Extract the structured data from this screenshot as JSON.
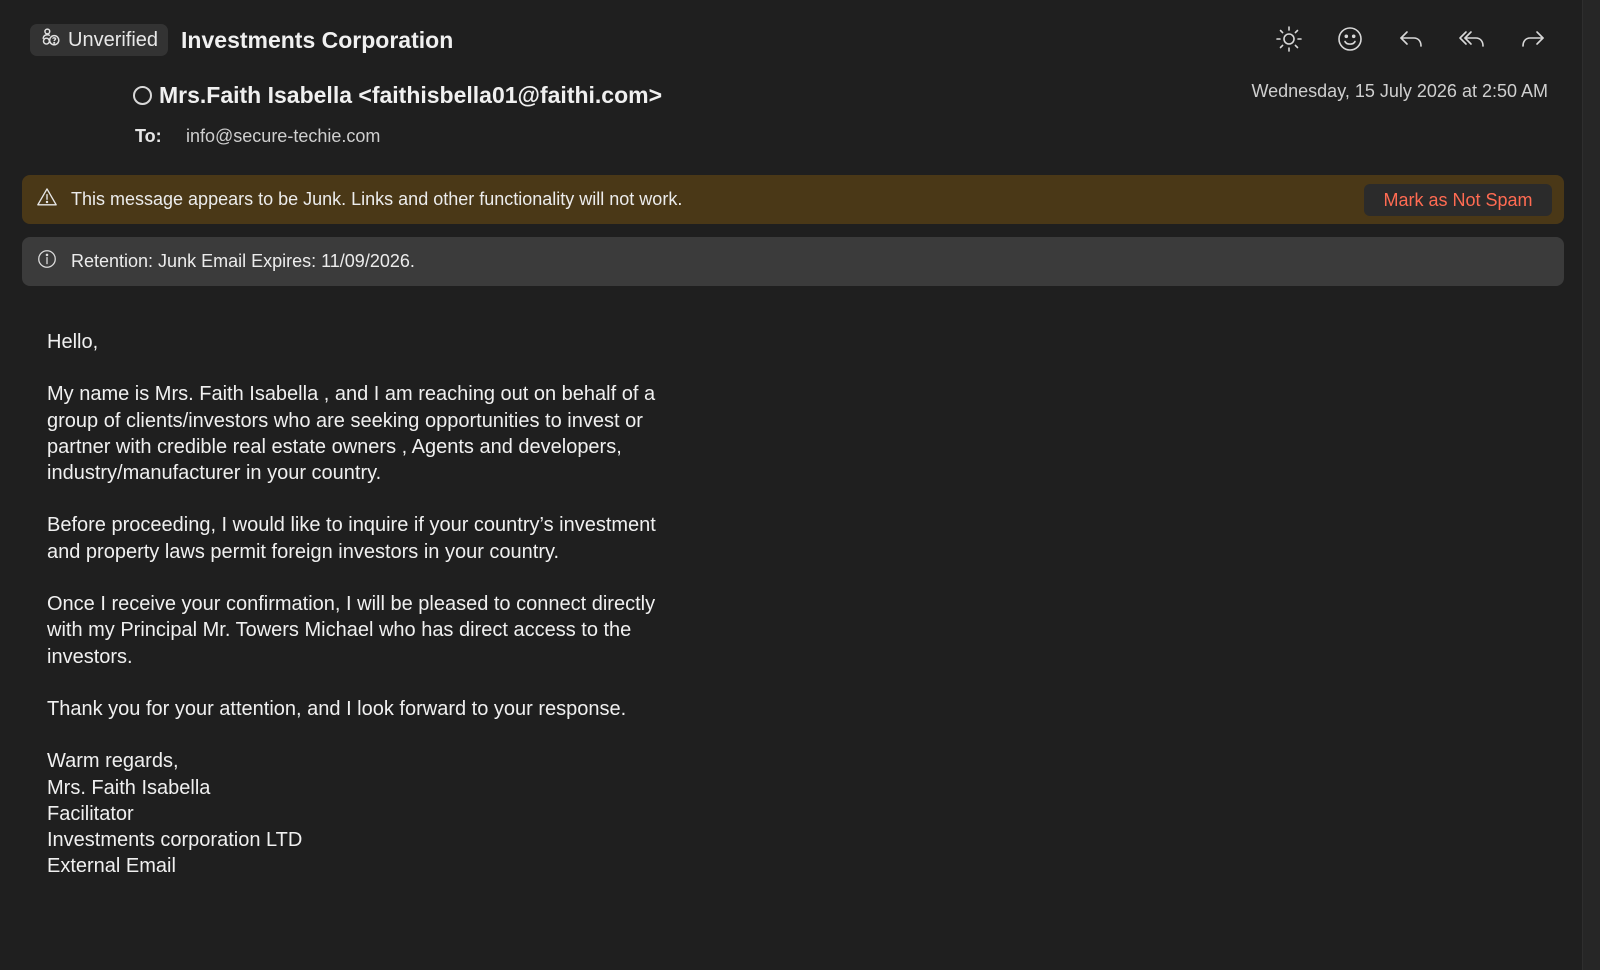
{
  "header": {
    "badge_label": "Unverified",
    "subject": "Investments Corporation"
  },
  "toolbar": {
    "items": [
      {
        "name": "brightness-icon"
      },
      {
        "name": "emoji-icon"
      },
      {
        "name": "reply-icon"
      },
      {
        "name": "reply-all-icon"
      },
      {
        "name": "forward-icon"
      }
    ]
  },
  "message": {
    "sender": "Mrs.Faith Isabella <faithisbella01@faithi.com>",
    "date": "Wednesday, 15 July 2026 at 2:50 AM",
    "to_label": "To:",
    "to_value": "info@secure-techie.com"
  },
  "junk_banner": {
    "text": "This message appears to be Junk. Links and other functionality will not work.",
    "button_label": "Mark as Not Spam",
    "button_color": "#ff6b52",
    "background": "#4a3817"
  },
  "retention_banner": {
    "text": "Retention: Junk Email Expires: 11/09/2026."
  },
  "body": {
    "greeting": "Hello,",
    "paragraph1": "My name is Mrs. Faith Isabella , and I am reaching out on behalf of a group of clients/investors who are seeking opportunities to invest or partner with credible real estate owners , Agents and developers, industry/manufacturer in your country.",
    "paragraph2": "Before proceeding, I would like to inquire if your country’s investment and property laws permit foreign investors in your country.",
    "paragraph3": "Once I receive your confirmation, I will be pleased to connect directly with my Principal Mr. Towers Michael who has direct access to the investors.",
    "paragraph4": "Thank you for your attention, and I look forward to your response.",
    "signature": [
      "Warm regards,",
      "Mrs. Faith Isabella",
      "Facilitator",
      "Investments corporation LTD",
      "External Email"
    ]
  }
}
